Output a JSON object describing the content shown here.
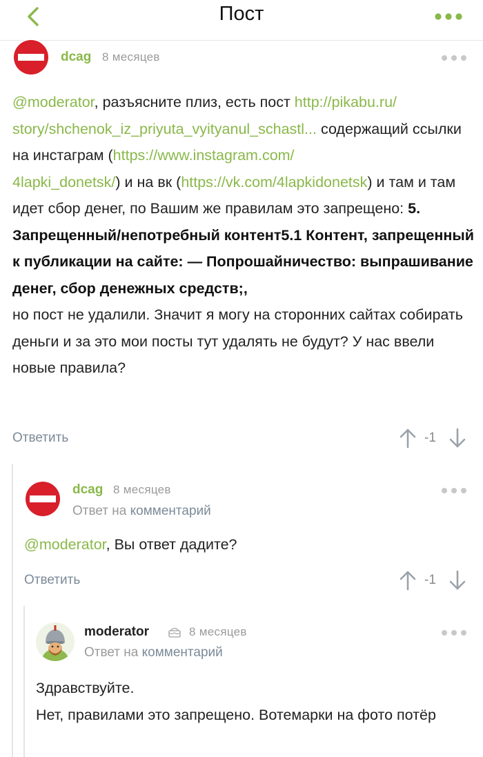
{
  "header": {
    "title": "Пост"
  },
  "comments": [
    {
      "author": "dcag",
      "time": "8 месяцев",
      "body": {
        "mention": "@moderator",
        "t1": ",  разъясните плиз, есть пост ",
        "link1_a": "http://pikabu.ru/",
        "link1_b": "story/shchenok_iz_priyuta_vyityanul_schastl...",
        "t2": " содержащий ссылки на инстаграм (",
        "link2_a": "https://www.instagram.com/",
        "link2_b": "4lapki_donetsk/",
        "t3": ") и на вк (",
        "link3": "https://vk.com/4lapkidonetsk",
        "t4": ") и там и там идет сбор денег, по Вашим же правилам это запрещено: ",
        "bold": "5. Запрещенный/непотребный контент5.1 Контент, запрещенный к публикации на сайте: — Попрошайничество: выпрашивание денег, сбор денежных средств;,",
        "t5": "но пост не удалили. Значит я могу на сторонних сайтах собирать деньги и за это мои посты тут удалять не будут? У нас ввели новые правила?"
      },
      "reply_label": "Ответить",
      "score": "-1"
    },
    {
      "author": "dcag",
      "time": "8 месяцев",
      "reply_prefix": "Ответ на",
      "reply_link": "комментарий",
      "body": {
        "mention": "@moderator",
        "text": ",  Вы ответ дадите?"
      },
      "reply_label": "Ответить",
      "score": "-1"
    },
    {
      "author": "moderator",
      "time": "8 месяцев",
      "reply_prefix": "Ответ на",
      "reply_link": "комментарий",
      "body": {
        "line1": "Здравствуйте.",
        "line2": "Нет, правилами это запрещено. Вотемарки на фото потёр"
      }
    }
  ],
  "colors": {
    "accent_green": "#8ab84a",
    "muted_gray": "#9a9a9a",
    "link_gray": "#7b8a98",
    "stop_red": "#d81f2a"
  },
  "icons": {
    "back": "chevron-left-icon",
    "menu": "more-dots-icon",
    "vote_up": "arrow-up-icon",
    "vote_down": "arrow-down-icon",
    "badge": "cake-badge-icon",
    "avatar_dcag": "stop-sign-avatar",
    "avatar_moderator": "knight-avatar"
  }
}
